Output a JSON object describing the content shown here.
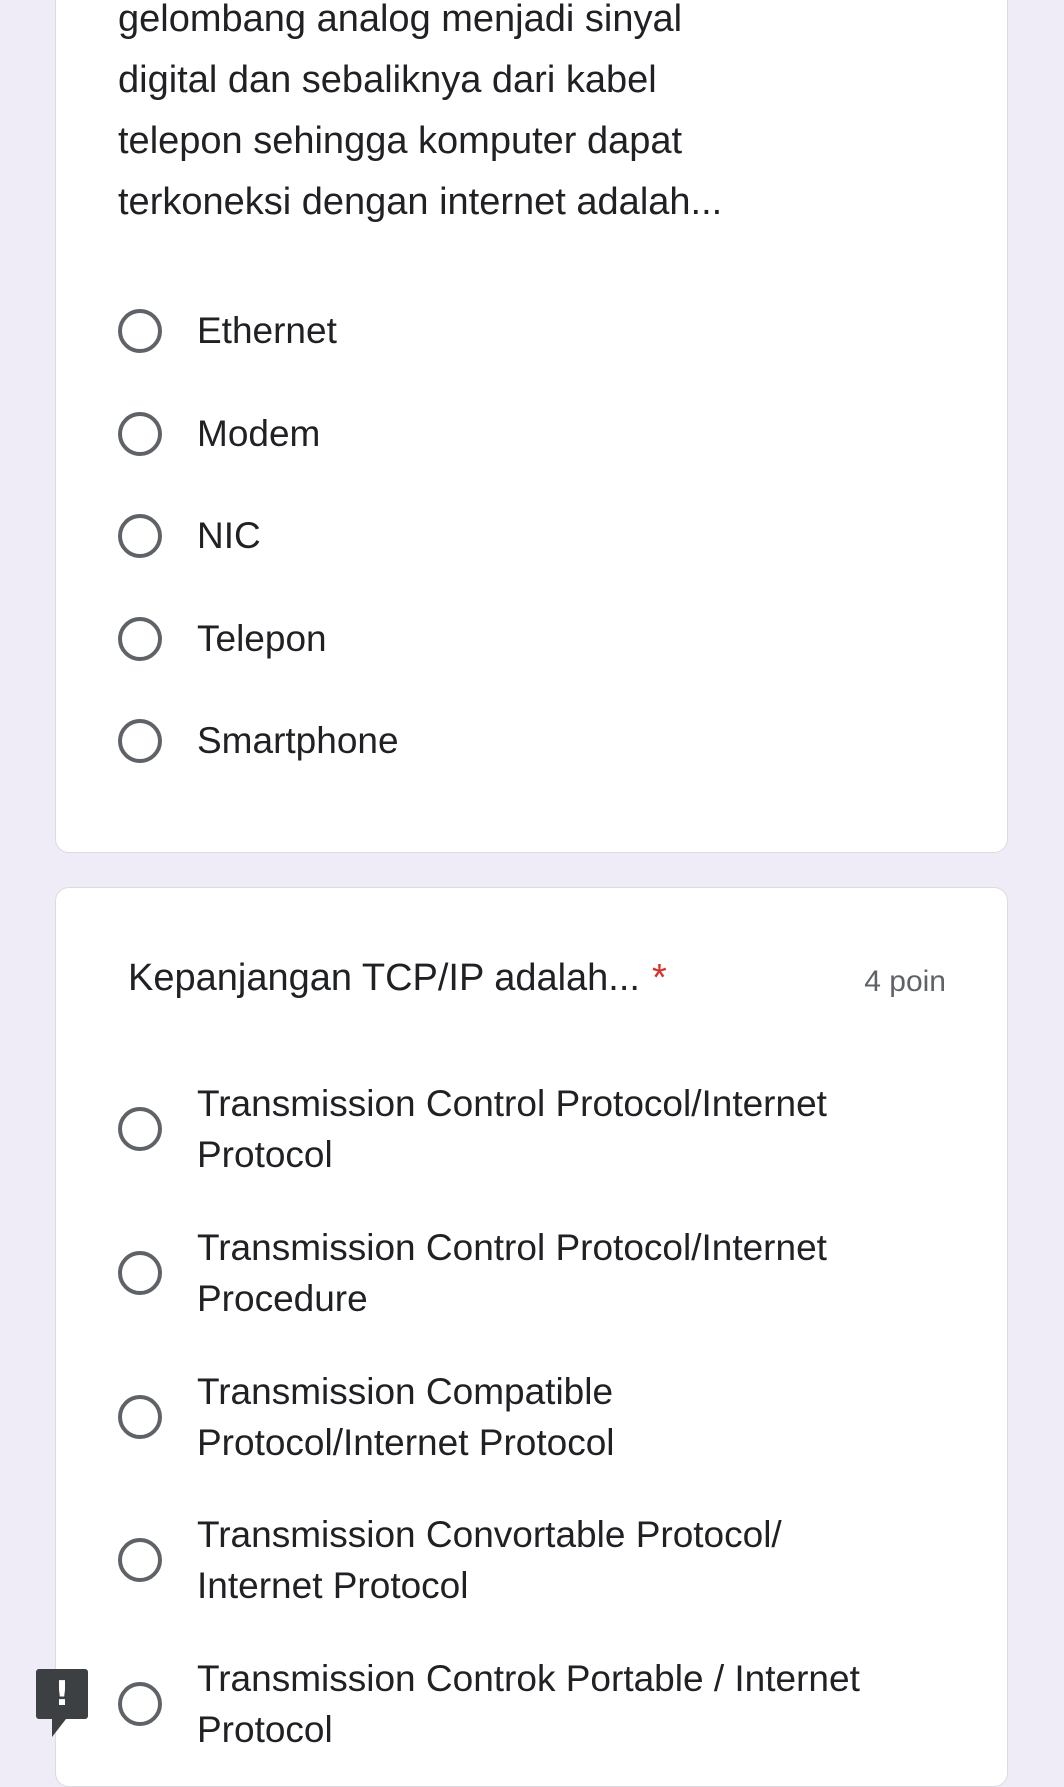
{
  "question1": {
    "text_lines": [
      "gelombang analog menjadi sinyal",
      "digital dan sebaliknya dari kabel",
      "telepon sehingga komputer dapat",
      "terkoneksi dengan internet adalah..."
    ],
    "options": [
      "Ethernet",
      "Modem",
      "NIC",
      "Telepon",
      "Smartphone"
    ]
  },
  "question2": {
    "title": "Kepanjangan TCP/IP adalah...",
    "required_mark": "*",
    "points": "4 poin",
    "options": [
      [
        "Transmission Control Protocol/Internet",
        "Protocol"
      ],
      [
        "Transmission Control Protocol/Internet",
        "Procedure"
      ],
      [
        "Transmission Compatible",
        "Protocol/Internet Protocol"
      ],
      [
        "Transmission Convortable Protocol/",
        "Internet Protocol"
      ],
      [
        "Transmission Controk Portable / Internet",
        "Protocol"
      ]
    ]
  },
  "alert_badge": {
    "symbol": "!"
  }
}
